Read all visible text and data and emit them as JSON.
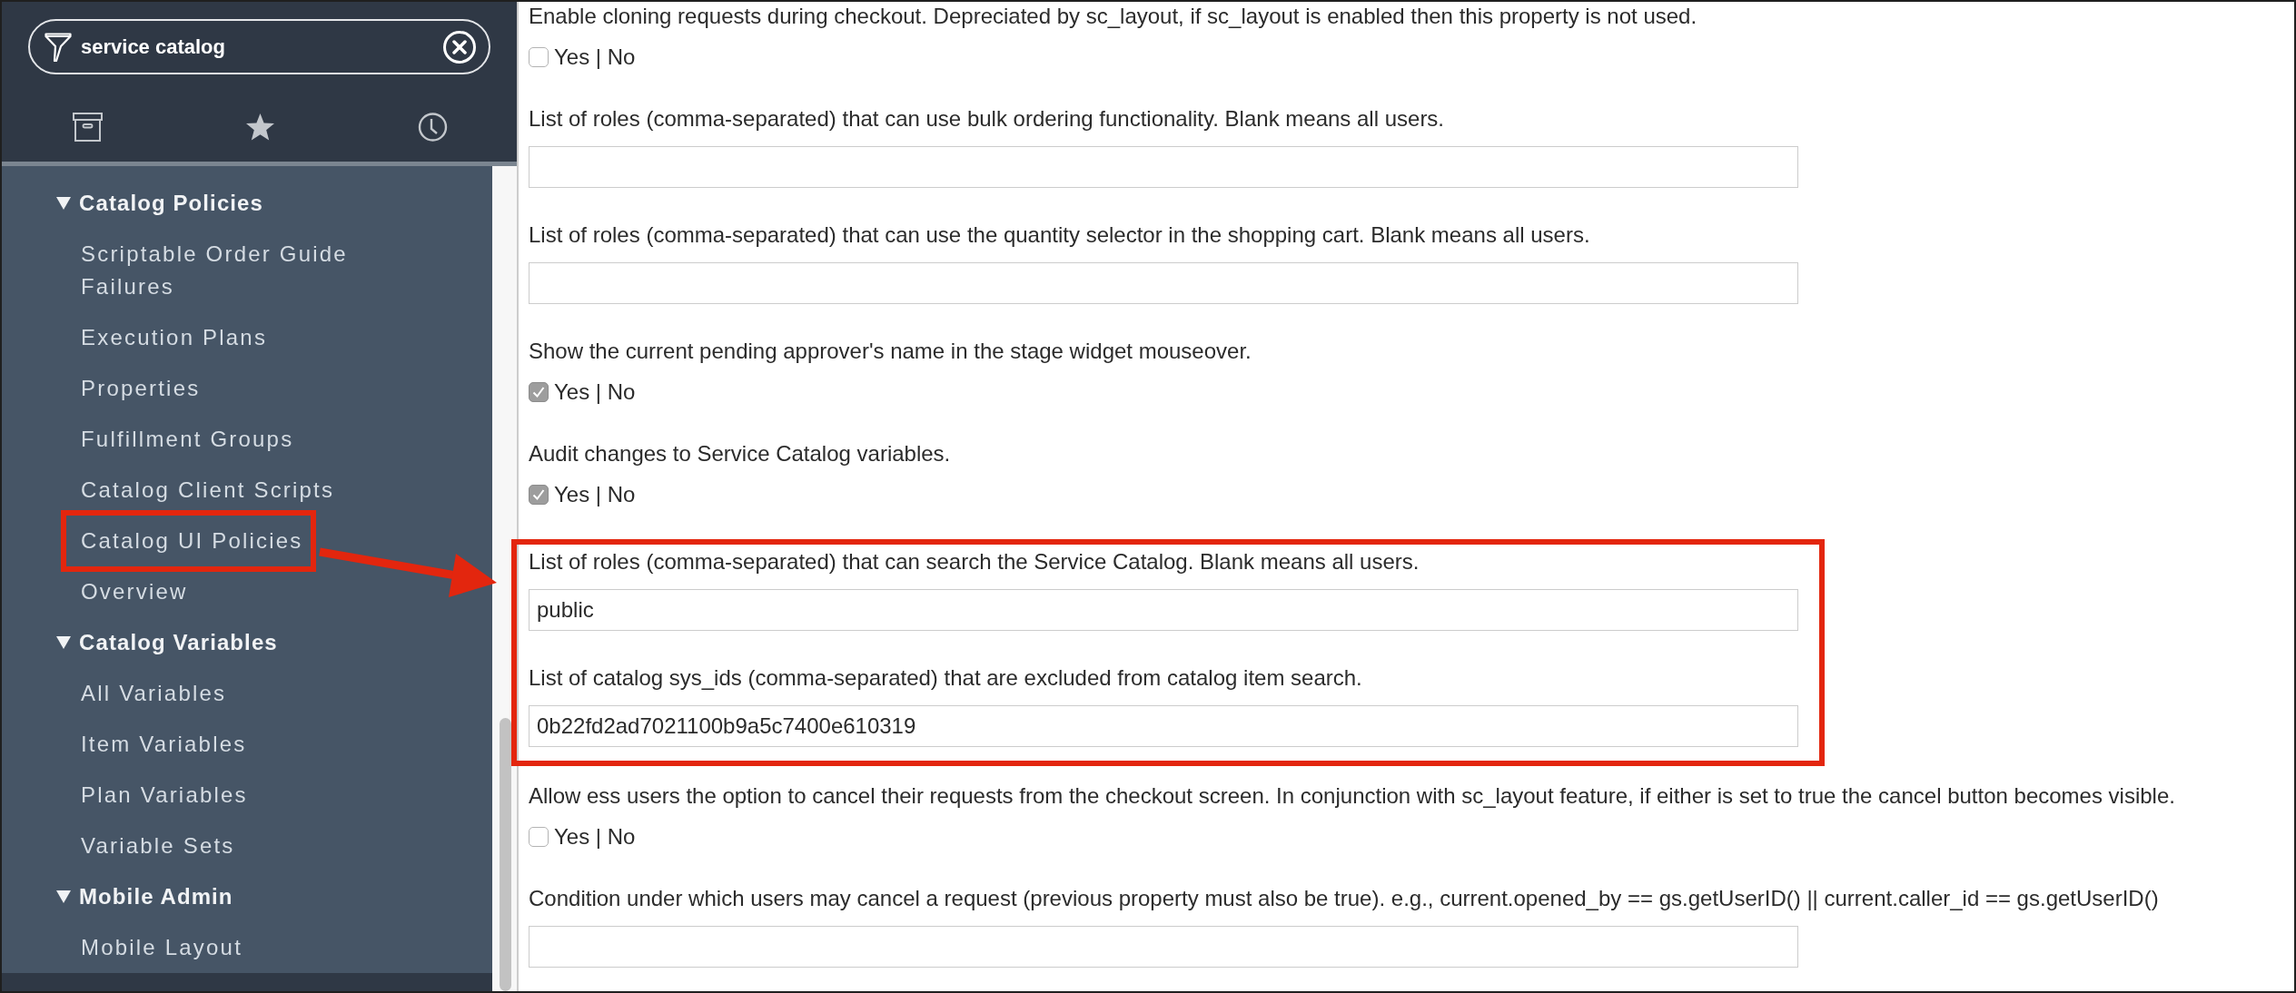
{
  "sidebar": {
    "search": {
      "value": "service catalog"
    },
    "groups": [
      {
        "label": "Catalog Policies",
        "expanded": true,
        "children": [
          {
            "label": "Scriptable Order Guide Failures",
            "annotated": false
          },
          {
            "label": "Execution Plans",
            "annotated": false
          },
          {
            "label": "Properties",
            "annotated": false
          },
          {
            "label": "Fulfillment Groups",
            "annotated": false
          },
          {
            "label": "Catalog Client Scripts",
            "annotated": false
          },
          {
            "label": "Catalog UI Policies",
            "annotated": true
          },
          {
            "label": "Overview",
            "annotated": false
          }
        ]
      },
      {
        "label": "Catalog Variables",
        "expanded": true,
        "children": [
          {
            "label": "All Variables",
            "annotated": false
          },
          {
            "label": "Item Variables",
            "annotated": false
          },
          {
            "label": "Plan Variables",
            "annotated": false
          },
          {
            "label": "Variable Sets",
            "annotated": false
          }
        ]
      },
      {
        "label": "Mobile Admin",
        "expanded": true,
        "children": [
          {
            "label": "Mobile Layout",
            "annotated": false
          }
        ]
      }
    ]
  },
  "properties": [
    {
      "kind": "checkbox",
      "label": "Enable cloning requests during checkout. Depreciated by sc_layout, if sc_layout is enabled then this property is not used.",
      "checked": false,
      "option_label": "Yes | No",
      "annotated": false
    },
    {
      "kind": "text",
      "label": "List of roles (comma-separated) that can use bulk ordering functionality. Blank means all users.",
      "annotated": false
    },
    {
      "kind": "text",
      "label": "List of roles (comma-separated) that can use the quantity selector in the shopping cart. Blank means all users.",
      "annotated": false
    },
    {
      "kind": "checkbox",
      "label": "Show the current pending approver's name in the stage widget mouseover.",
      "checked": true,
      "option_label": "Yes | No",
      "annotated": false
    },
    {
      "kind": "checkbox",
      "label": "Audit changes to Service Catalog variables.",
      "checked": true,
      "option_label": "Yes | No",
      "annotated": false
    },
    {
      "kind": "text",
      "label": "List of roles (comma-separated) that can search the Service Catalog. Blank means all users.",
      "value": "public",
      "annotated": true
    },
    {
      "kind": "text",
      "label": "List of catalog sys_ids (comma-separated) that are excluded from catalog item search.",
      "value": "0b22fd2ad7021100b9a5c7400e610319",
      "annotated": true
    },
    {
      "kind": "checkbox",
      "label": "Allow ess users the option to cancel their requests from the checkout screen. In conjunction with sc_layout feature, if either is set to true the cancel button becomes visible.",
      "checked": false,
      "option_label": "Yes | No",
      "annotated": false
    },
    {
      "kind": "text",
      "label": "Condition under which users may cancel a request (previous property must also be true). e.g., current.opened_by == gs.getUserID() || current.caller_id == gs.getUserID()",
      "annotated": false
    }
  ]
}
